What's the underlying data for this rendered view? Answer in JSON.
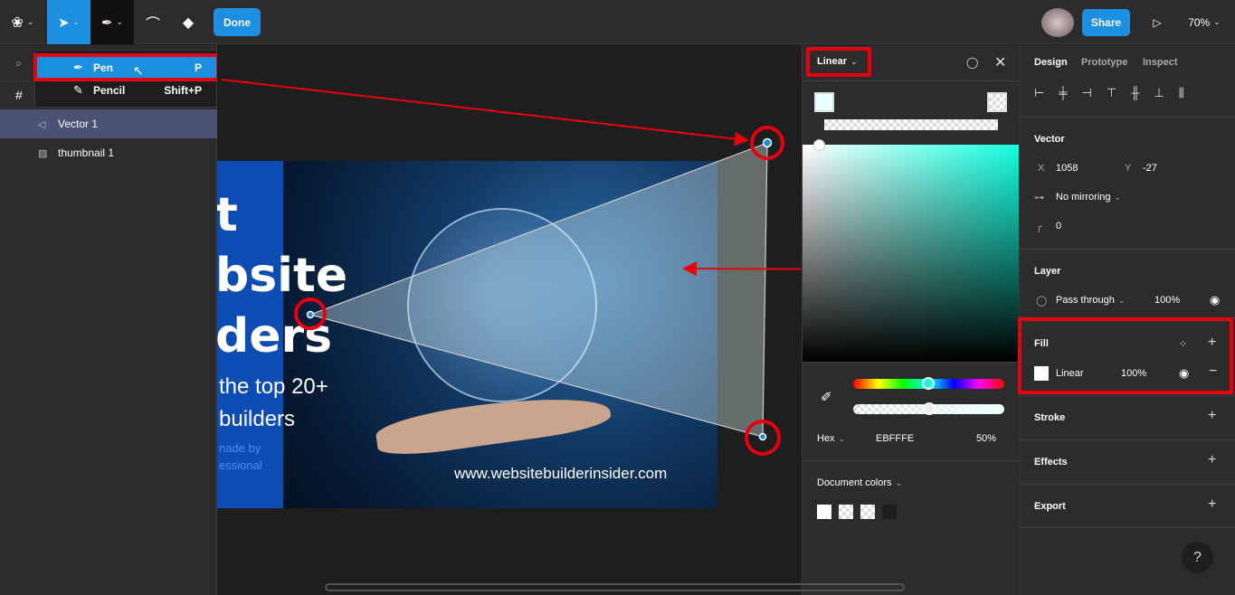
{
  "toolbar": {
    "done_label": "Done",
    "share_label": "Share",
    "zoom": "70%"
  },
  "tool_menu": {
    "items": [
      {
        "label": "Pen",
        "shortcut": "P"
      },
      {
        "label": "Pencil",
        "shortcut": "Shift+P"
      }
    ]
  },
  "layers": [
    {
      "name": "Vector 1",
      "icon": "vector-icon"
    },
    {
      "name": "thumbnail 1",
      "icon": "image-icon"
    }
  ],
  "canvas": {
    "image_text": {
      "line1": "t",
      "line2": "bsite",
      "line3": "ders",
      "line4": "the top 20+",
      "line5": "builders",
      "line6": "nade by",
      "line7": "essional",
      "url": "www.websitebuilderinsider.com"
    }
  },
  "picker": {
    "type": "Linear",
    "format": "Hex",
    "hex": "EBFFFE",
    "opacity": "50%",
    "document_colors_label": "Document colors",
    "hue_fraction": 0.49,
    "alpha_fraction": 0.5
  },
  "design": {
    "tabs": [
      "Design",
      "Prototype",
      "Inspect"
    ],
    "vector": {
      "title": "Vector",
      "x_label": "X",
      "x": "1058",
      "y_label": "Y",
      "y": "-27",
      "mirroring": "No mirroring",
      "corner": "0"
    },
    "layer": {
      "title": "Layer",
      "blend": "Pass through",
      "opacity": "100%"
    },
    "fill": {
      "title": "Fill",
      "type": "Linear",
      "opacity": "100%"
    },
    "stroke": "Stroke",
    "effects": "Effects",
    "export": "Export"
  },
  "help": "?",
  "colors": {
    "accent": "#1c8fe0",
    "annotation": "#e8000e",
    "panel": "#2c2c2c",
    "canvas": "#1e1e1e"
  }
}
